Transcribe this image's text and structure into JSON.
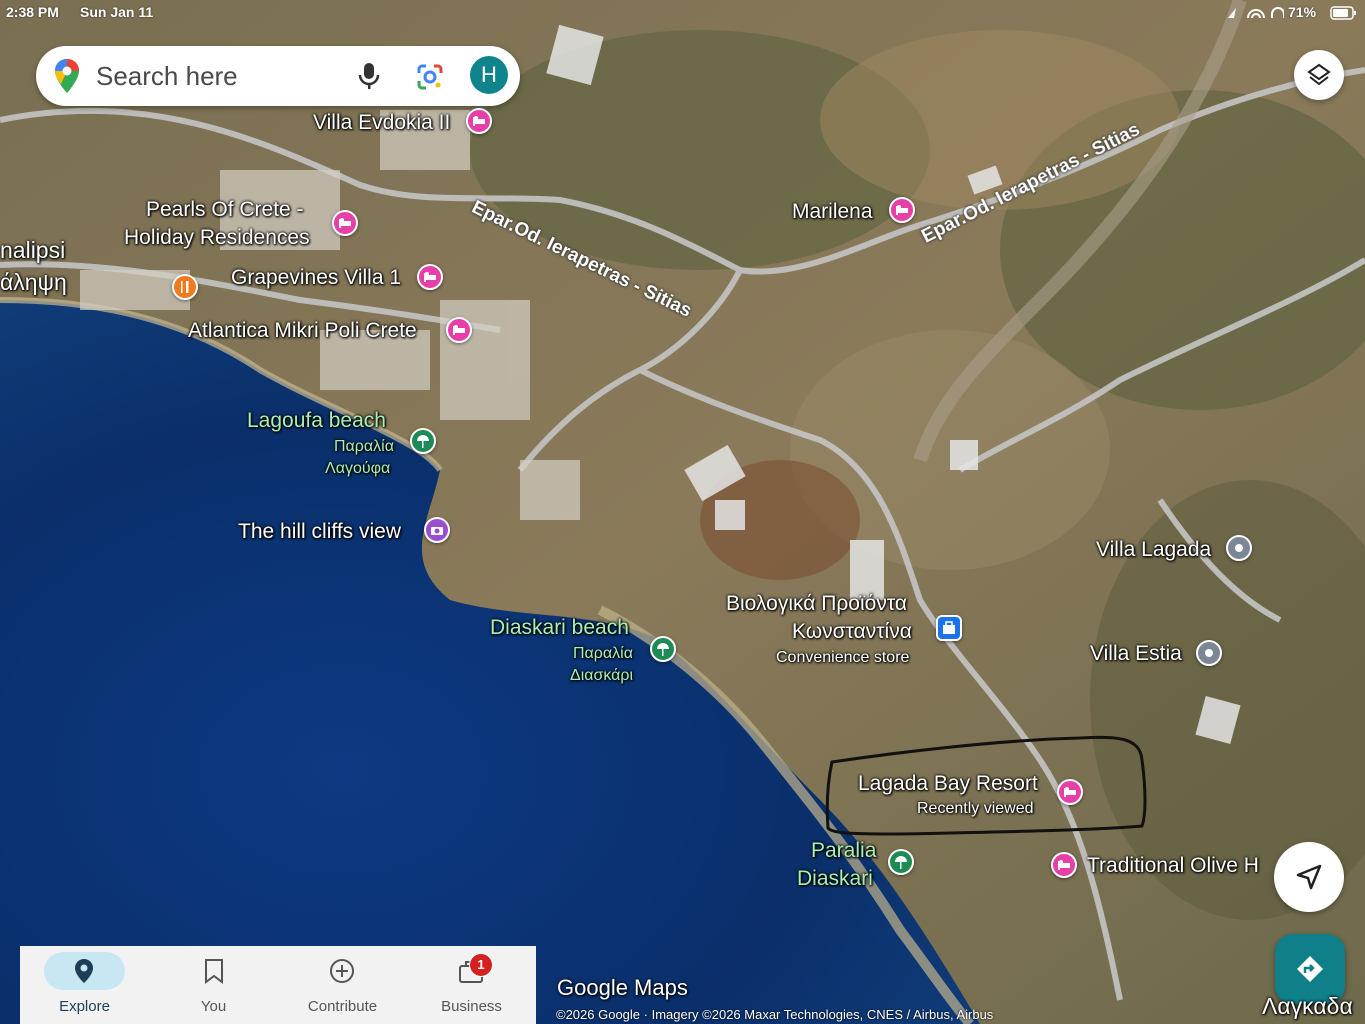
{
  "status_bar": {
    "time": "2:38 PM",
    "date": "Sun Jan 11",
    "battery": "71%"
  },
  "search": {
    "placeholder": "Search here",
    "avatar_initial": "H"
  },
  "map_labels": {
    "villa_evdokia": "Villa Evdokia II",
    "pearls_line1": "Pearls Of Crete -",
    "pearls_line2": "Holiday Residences",
    "grapevines": "Grapevines Villa 1",
    "atlantica": "Atlantica Mikri Poli Crete",
    "lagoufa_en": "Lagoufa beach",
    "lagoufa_gr1": "Παραλία",
    "lagoufa_gr2": "Λαγούφα",
    "hill_cliffs": "The hill cliffs view",
    "diaskari_en": "Diaskari beach",
    "diaskari_gr1": "Παραλία",
    "diaskari_gr2": "Διασκάρι",
    "marilena": "Marilena",
    "road_left": "Epar.Od. Ierapetras - Sitias",
    "road_right": "Epar.Od. Ierapetras - Sitias",
    "bio_line1": "Βιολογικά Προϊόντα",
    "bio_line2": "Κωνσταντίνα",
    "bio_sub": "Convenience store",
    "villa_lagada": "Villa Lagada",
    "villa_estia": "Villa Estia",
    "lagada_resort": "Lagada Bay Resort",
    "recently_viewed": "Recently viewed",
    "paralia_diaskari_1": "Paralia",
    "paralia_diaskari_2": "Diaskari",
    "traditional": "Traditional Olive H",
    "town_en": "nalipsi",
    "town_gr": "άληψη",
    "edge_gr": "Λαγκαδα"
  },
  "bottom_nav": {
    "items": [
      {
        "label": "Explore",
        "icon": "explore-pin-icon",
        "active": true
      },
      {
        "label": "You",
        "icon": "bookmark-icon",
        "active": false
      },
      {
        "label": "Contribute",
        "icon": "plus-circle-icon",
        "active": false
      },
      {
        "label": "Business",
        "icon": "store-icon",
        "active": false
      }
    ],
    "business_badge": "1"
  },
  "watermark": "Google Maps",
  "attribution": "©2026 Google · Imagery ©2026 Maxar Technologies, CNES / Airbus, Airbus",
  "colors": {
    "sea_deep": "#0a2f6b",
    "hotel_pin": "#e83ea8",
    "beach_pin": "#1e8b55",
    "accent_teal": "#0f7f8a"
  }
}
